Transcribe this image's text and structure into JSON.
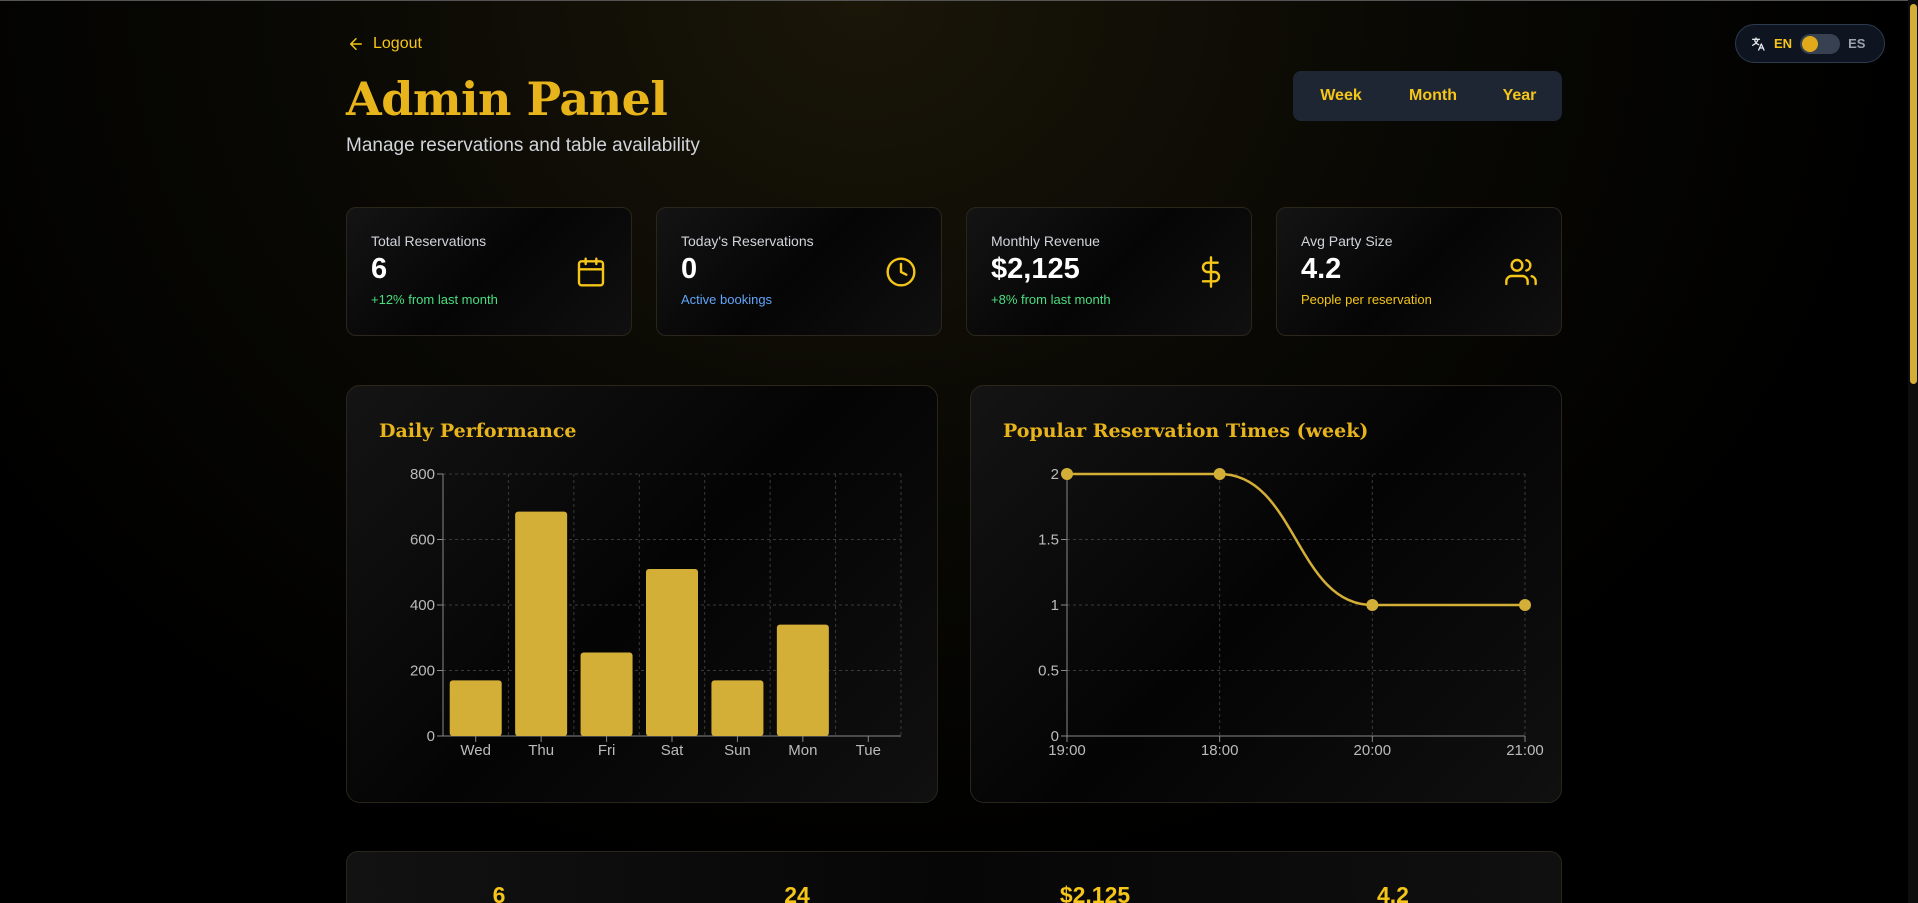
{
  "header": {
    "logout_label": "Logout",
    "title": "Admin Panel",
    "subtitle": "Manage reservations and table availability"
  },
  "language": {
    "left": "EN",
    "right": "ES"
  },
  "periods": [
    {
      "label": "Week",
      "active": true
    },
    {
      "label": "Month",
      "active": false
    },
    {
      "label": "Year",
      "active": false
    }
  ],
  "stats": [
    {
      "label": "Total Reservations",
      "value": "6",
      "note": "+12% from last month",
      "icon": "calendar-icon",
      "note_color": "#4ade80"
    },
    {
      "label": "Today's Reservations",
      "value": "0",
      "note": "Active bookings",
      "icon": "clock-icon",
      "note_color": "#60a5fa"
    },
    {
      "label": "Monthly Revenue",
      "value": "$2,125",
      "note": "+8% from last month",
      "icon": "dollar-icon",
      "note_color": "#4ade80"
    },
    {
      "label": "Avg Party Size",
      "value": "4.2",
      "note": "People per reservation",
      "icon": "users-icon",
      "note_color": "#f5c518"
    }
  ],
  "colors": {
    "accent": "#f5c518",
    "bar": "#d4af37"
  },
  "chart_data": [
    {
      "type": "bar",
      "title": "Daily Performance",
      "categories": [
        "Wed",
        "Thu",
        "Fri",
        "Sat",
        "Sun",
        "Mon",
        "Tue"
      ],
      "values": [
        170,
        685,
        255,
        510,
        170,
        340,
        0
      ],
      "yticks": [
        "0",
        "200",
        "400",
        "600",
        "800"
      ],
      "ylim": [
        0,
        800
      ],
      "grid": true
    },
    {
      "type": "line",
      "title": "Popular Reservation Times (week)",
      "categories": [
        "19:00",
        "18:00",
        "20:00",
        "21:00"
      ],
      "values": [
        2,
        2,
        1,
        1
      ],
      "yticks": [
        "0",
        "0.5",
        "1",
        "1.5",
        "2"
      ],
      "ylim": [
        0,
        2
      ],
      "grid": true
    }
  ],
  "bottom_stats": [
    "6",
    "24",
    "$2,125",
    "4.2"
  ]
}
